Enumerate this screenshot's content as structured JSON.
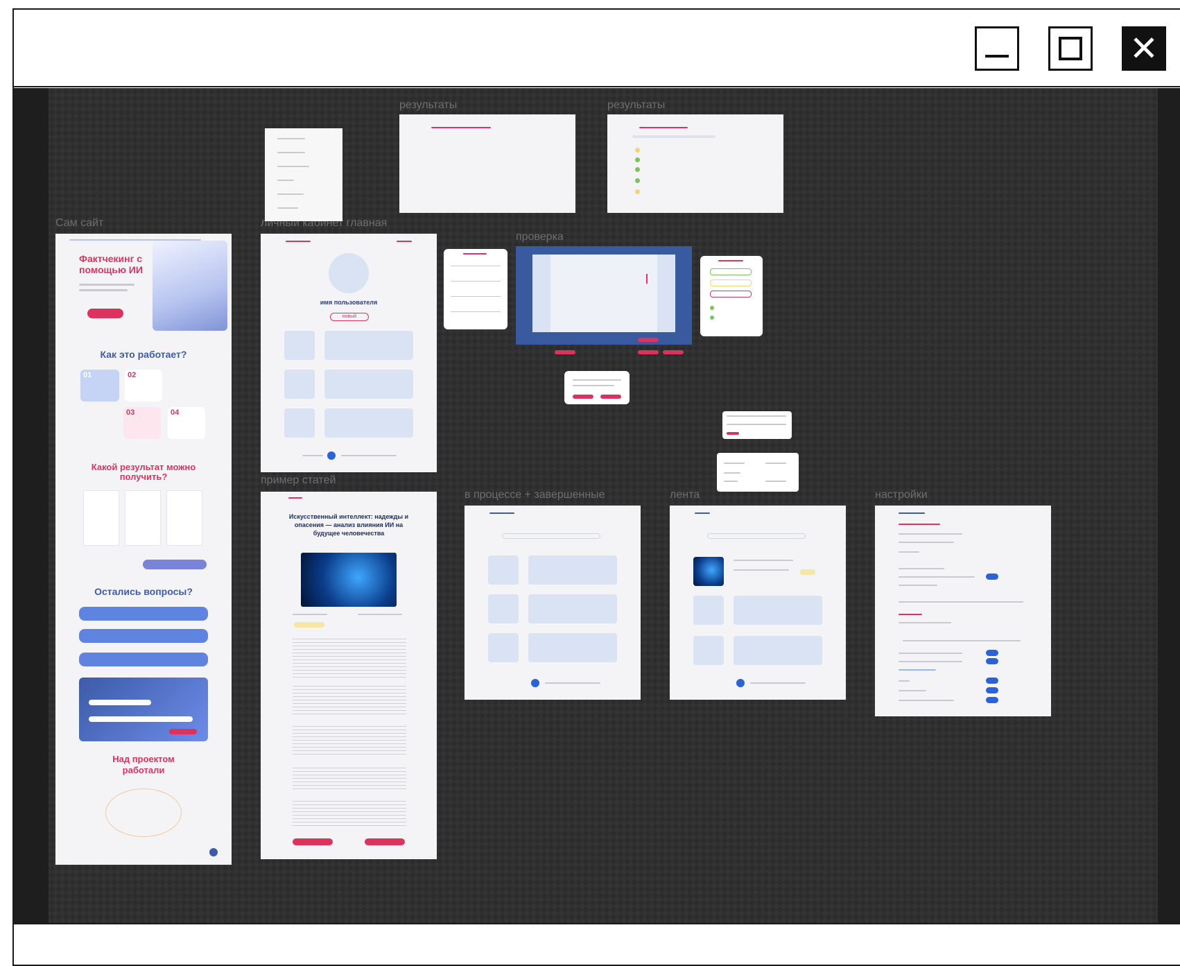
{
  "window": {
    "controls": {
      "minimize": "minimize-icon",
      "maximize": "maximize-icon",
      "close": "✕"
    }
  },
  "frames": {
    "site": "Сам сайт",
    "cabinet": "личный кабинет главная",
    "results1": "результаты",
    "results2": "результаты",
    "check": "проверка",
    "articles": "пример статей",
    "in_progress": "в процессе + завершенные",
    "feed": "лента",
    "settings": "настройки"
  },
  "site": {
    "hero_title": "Фактчекинг с помощью ИИ",
    "how_title": "Как это работает?",
    "steps": [
      "01",
      "02",
      "03",
      "04"
    ],
    "result_title": "Какой результат можно получить?",
    "questions_title": "Остались вопросы?",
    "team_title": "Над проектом работали"
  },
  "cabinet": {
    "username": "имя пользователя",
    "badge": "новый"
  },
  "article": {
    "title": "Искусственный интеллект: надежды и опасения — анализ влияния ИИ на будущее человечества"
  },
  "colors": {
    "accent": "#d9335e",
    "primary": "#3d5ba8",
    "placeholder": "#d9e3f4",
    "canvas": "#2c2c2c"
  }
}
